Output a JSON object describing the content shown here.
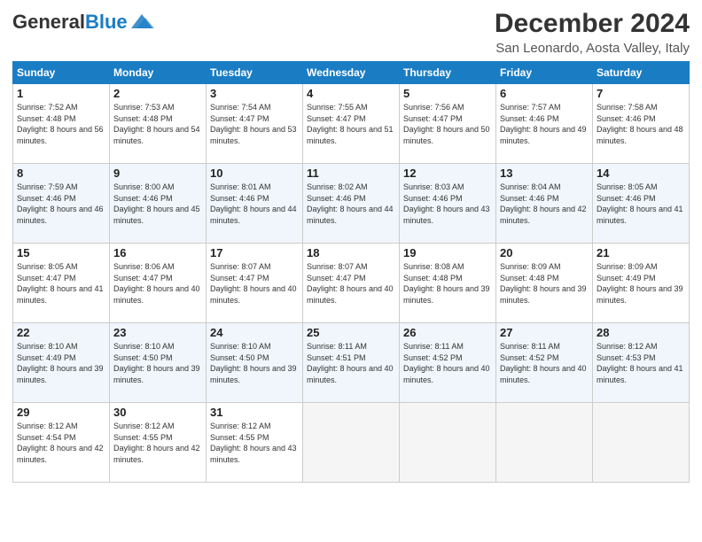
{
  "header": {
    "logo_general": "General",
    "logo_blue": "Blue",
    "month_title": "December 2024",
    "subtitle": "San Leonardo, Aosta Valley, Italy"
  },
  "days_of_week": [
    "Sunday",
    "Monday",
    "Tuesday",
    "Wednesday",
    "Thursday",
    "Friday",
    "Saturday"
  ],
  "weeks": [
    [
      {
        "day": "1",
        "sunrise": "7:52 AM",
        "sunset": "4:48 PM",
        "daylight": "8 hours and 56 minutes."
      },
      {
        "day": "2",
        "sunrise": "7:53 AM",
        "sunset": "4:48 PM",
        "daylight": "8 hours and 54 minutes."
      },
      {
        "day": "3",
        "sunrise": "7:54 AM",
        "sunset": "4:47 PM",
        "daylight": "8 hours and 53 minutes."
      },
      {
        "day": "4",
        "sunrise": "7:55 AM",
        "sunset": "4:47 PM",
        "daylight": "8 hours and 51 minutes."
      },
      {
        "day": "5",
        "sunrise": "7:56 AM",
        "sunset": "4:47 PM",
        "daylight": "8 hours and 50 minutes."
      },
      {
        "day": "6",
        "sunrise": "7:57 AM",
        "sunset": "4:46 PM",
        "daylight": "8 hours and 49 minutes."
      },
      {
        "day": "7",
        "sunrise": "7:58 AM",
        "sunset": "4:46 PM",
        "daylight": "8 hours and 48 minutes."
      }
    ],
    [
      {
        "day": "8",
        "sunrise": "7:59 AM",
        "sunset": "4:46 PM",
        "daylight": "8 hours and 46 minutes."
      },
      {
        "day": "9",
        "sunrise": "8:00 AM",
        "sunset": "4:46 PM",
        "daylight": "8 hours and 45 minutes."
      },
      {
        "day": "10",
        "sunrise": "8:01 AM",
        "sunset": "4:46 PM",
        "daylight": "8 hours and 44 minutes."
      },
      {
        "day": "11",
        "sunrise": "8:02 AM",
        "sunset": "4:46 PM",
        "daylight": "8 hours and 44 minutes."
      },
      {
        "day": "12",
        "sunrise": "8:03 AM",
        "sunset": "4:46 PM",
        "daylight": "8 hours and 43 minutes."
      },
      {
        "day": "13",
        "sunrise": "8:04 AM",
        "sunset": "4:46 PM",
        "daylight": "8 hours and 42 minutes."
      },
      {
        "day": "14",
        "sunrise": "8:05 AM",
        "sunset": "4:46 PM",
        "daylight": "8 hours and 41 minutes."
      }
    ],
    [
      {
        "day": "15",
        "sunrise": "8:05 AM",
        "sunset": "4:47 PM",
        "daylight": "8 hours and 41 minutes."
      },
      {
        "day": "16",
        "sunrise": "8:06 AM",
        "sunset": "4:47 PM",
        "daylight": "8 hours and 40 minutes."
      },
      {
        "day": "17",
        "sunrise": "8:07 AM",
        "sunset": "4:47 PM",
        "daylight": "8 hours and 40 minutes."
      },
      {
        "day": "18",
        "sunrise": "8:07 AM",
        "sunset": "4:47 PM",
        "daylight": "8 hours and 40 minutes."
      },
      {
        "day": "19",
        "sunrise": "8:08 AM",
        "sunset": "4:48 PM",
        "daylight": "8 hours and 39 minutes."
      },
      {
        "day": "20",
        "sunrise": "8:09 AM",
        "sunset": "4:48 PM",
        "daylight": "8 hours and 39 minutes."
      },
      {
        "day": "21",
        "sunrise": "8:09 AM",
        "sunset": "4:49 PM",
        "daylight": "8 hours and 39 minutes."
      }
    ],
    [
      {
        "day": "22",
        "sunrise": "8:10 AM",
        "sunset": "4:49 PM",
        "daylight": "8 hours and 39 minutes."
      },
      {
        "day": "23",
        "sunrise": "8:10 AM",
        "sunset": "4:50 PM",
        "daylight": "8 hours and 39 minutes."
      },
      {
        "day": "24",
        "sunrise": "8:10 AM",
        "sunset": "4:50 PM",
        "daylight": "8 hours and 39 minutes."
      },
      {
        "day": "25",
        "sunrise": "8:11 AM",
        "sunset": "4:51 PM",
        "daylight": "8 hours and 40 minutes."
      },
      {
        "day": "26",
        "sunrise": "8:11 AM",
        "sunset": "4:52 PM",
        "daylight": "8 hours and 40 minutes."
      },
      {
        "day": "27",
        "sunrise": "8:11 AM",
        "sunset": "4:52 PM",
        "daylight": "8 hours and 40 minutes."
      },
      {
        "day": "28",
        "sunrise": "8:12 AM",
        "sunset": "4:53 PM",
        "daylight": "8 hours and 41 minutes."
      }
    ],
    [
      {
        "day": "29",
        "sunrise": "8:12 AM",
        "sunset": "4:54 PM",
        "daylight": "8 hours and 42 minutes."
      },
      {
        "day": "30",
        "sunrise": "8:12 AM",
        "sunset": "4:55 PM",
        "daylight": "8 hours and 42 minutes."
      },
      {
        "day": "31",
        "sunrise": "8:12 AM",
        "sunset": "4:55 PM",
        "daylight": "8 hours and 43 minutes."
      },
      null,
      null,
      null,
      null
    ]
  ]
}
